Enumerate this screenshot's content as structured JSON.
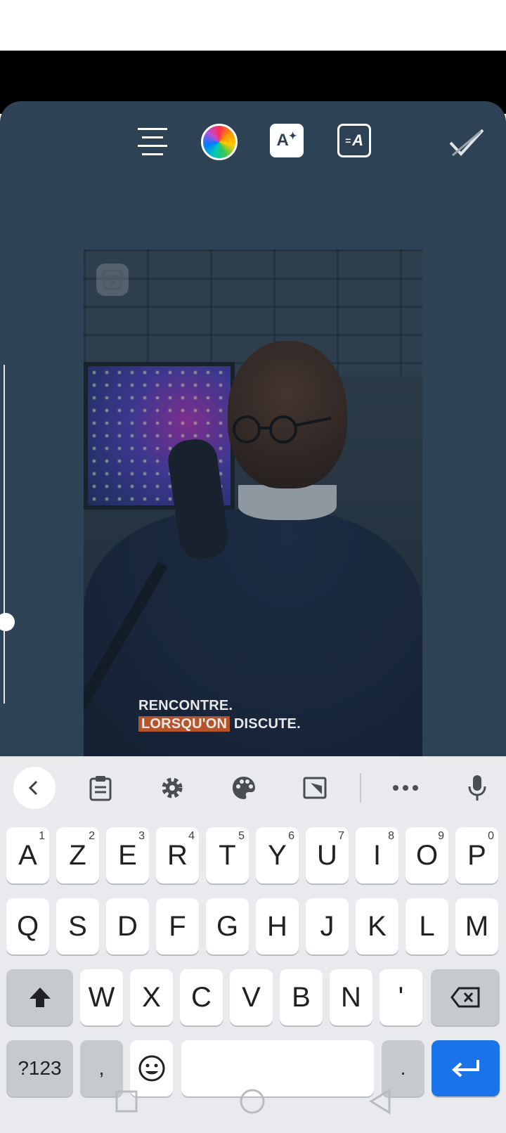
{
  "editor": {
    "toolbar": {
      "align_icon": "align-center-icon",
      "color_icon": "color-wheel-icon",
      "effect_label": "A",
      "effect_icon": "text-sparkle-icon",
      "animation_label": "A",
      "animation_icon": "text-animation-icon",
      "done_icon": "checkmark-icon"
    },
    "video": {
      "logo_icon": "reels-icon",
      "caption_line1": "RENCONTRE.",
      "caption_line2_highlight": "LORSQU'ON",
      "caption_line2_rest": "DISCUTE."
    },
    "text_size_slider": {
      "value_fraction": 0.76
    }
  },
  "keyboard": {
    "tools": [
      "back-icon",
      "clipboard-icon",
      "settings-icon",
      "palette-icon",
      "resize-icon",
      "more-icon",
      "microphone-icon"
    ],
    "row1": [
      {
        "label": "A",
        "hint": "1"
      },
      {
        "label": "Z",
        "hint": "2"
      },
      {
        "label": "E",
        "hint": "3"
      },
      {
        "label": "R",
        "hint": "4"
      },
      {
        "label": "T",
        "hint": "5"
      },
      {
        "label": "Y",
        "hint": "6"
      },
      {
        "label": "U",
        "hint": "7"
      },
      {
        "label": "I",
        "hint": "8"
      },
      {
        "label": "O",
        "hint": "9"
      },
      {
        "label": "P",
        "hint": "0"
      }
    ],
    "row2": [
      "Q",
      "S",
      "D",
      "F",
      "G",
      "H",
      "J",
      "K",
      "L",
      "M"
    ],
    "row3": [
      "W",
      "X",
      "C",
      "V",
      "B",
      "N",
      "'"
    ],
    "row4": {
      "symbols": "?123",
      "comma": ",",
      "period": "."
    },
    "colors": {
      "accent": "#1a73e8",
      "key": "#ffffff",
      "dark_key": "#c6cacf"
    }
  },
  "navbar": {
    "icons": [
      "recents-icon",
      "home-icon",
      "back-nav-icon"
    ]
  }
}
